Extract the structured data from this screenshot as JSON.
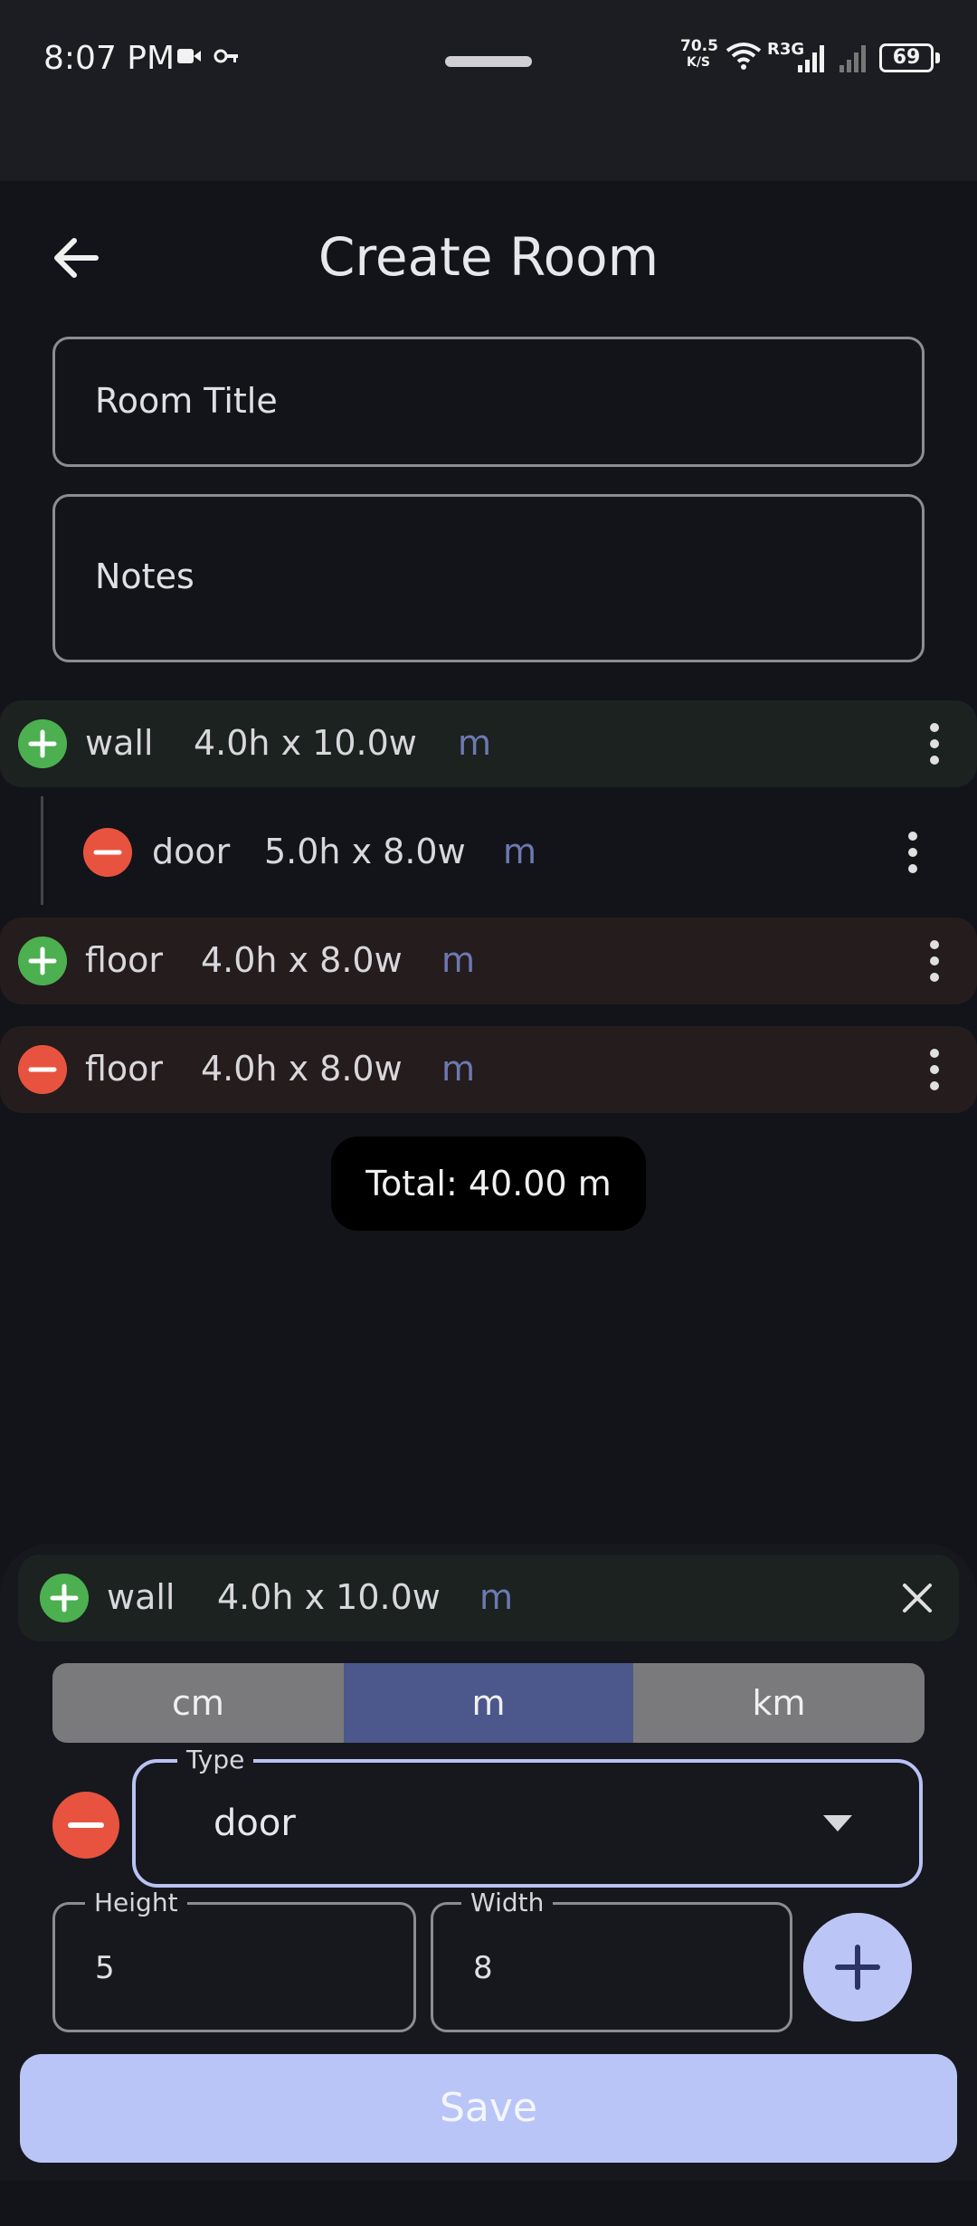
{
  "status_bar": {
    "time": "8:07 PM",
    "net_speed_value": "70.5",
    "net_speed_unit": "K/S",
    "network_label": "R3G",
    "battery": "69"
  },
  "header": {
    "title": "Create Room"
  },
  "form": {
    "room_title_placeholder": "Room Title",
    "notes_placeholder": "Notes"
  },
  "items": [
    {
      "action": "add",
      "type": "wall",
      "dims": "4.0h x 10.0w",
      "unit": "m"
    },
    {
      "action": "remove",
      "type": "door",
      "dims": "5.0h x 8.0w",
      "unit": "m"
    },
    {
      "action": "add",
      "type": "floor",
      "dims": "4.0h x 8.0w",
      "unit": "m"
    },
    {
      "action": "remove",
      "type": "floor",
      "dims": "4.0h x 8.0w",
      "unit": "m"
    }
  ],
  "total": "Total: 40.00 m",
  "editor": {
    "parent": {
      "type": "wall",
      "dims": "4.0h x 10.0w",
      "unit": "m"
    },
    "units": [
      "cm",
      "m",
      "km"
    ],
    "selected_unit": "m",
    "type_label": "Type",
    "type_value": "door",
    "height_label": "Height",
    "height_value": "5",
    "width_label": "Width",
    "width_value": "8"
  },
  "save_label": "Save",
  "colors": {
    "accent": "#bac5f7",
    "selected_unit": "#4c588b",
    "unselected_unit": "#7a7a7c",
    "add": "#4caf50",
    "remove": "#e8533f",
    "unit_text": "#6d79b3"
  },
  "icons": {
    "back": "arrow-left-icon",
    "add": "plus-circle-icon",
    "remove": "minus-circle-icon",
    "menu": "more-vert-icon",
    "close": "close-icon",
    "dropdown": "caret-down-icon"
  }
}
